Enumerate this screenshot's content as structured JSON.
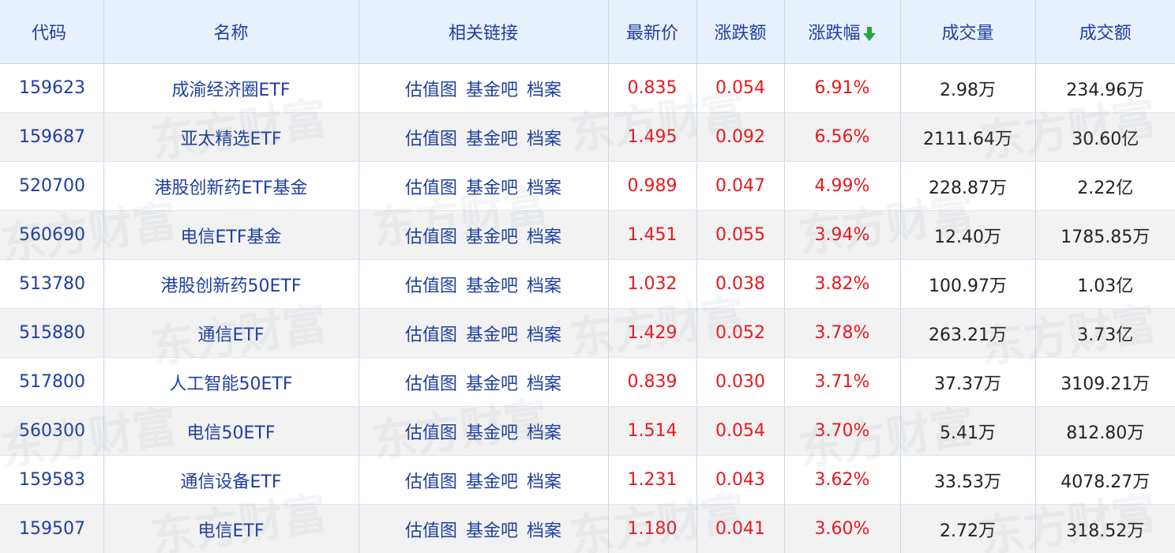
{
  "table": {
    "headers": [
      "代码",
      "名称",
      "相关链接",
      "最新价",
      "涨跌额",
      "涨跌幅",
      "成交量",
      "成交额"
    ],
    "sort_column": "涨跌幅",
    "sort_direction": "descending",
    "sort_icon": "green-arrow-down-icon",
    "link_labels": [
      "估值图",
      "基金吧",
      "档案"
    ],
    "rows": [
      {
        "code": "159623",
        "name": "成渝经济圈ETF",
        "price": "0.835",
        "change": "0.054",
        "pct": "6.91%",
        "volume": "2.98万",
        "amount": "234.96万"
      },
      {
        "code": "159687",
        "name": "亚太精选ETF",
        "price": "1.495",
        "change": "0.092",
        "pct": "6.56%",
        "volume": "2111.64万",
        "amount": "30.60亿"
      },
      {
        "code": "520700",
        "name": "港股创新药ETF基金",
        "price": "0.989",
        "change": "0.047",
        "pct": "4.99%",
        "volume": "228.87万",
        "amount": "2.22亿"
      },
      {
        "code": "560690",
        "name": "电信ETF基金",
        "price": "1.451",
        "change": "0.055",
        "pct": "3.94%",
        "volume": "12.40万",
        "amount": "1785.85万"
      },
      {
        "code": "513780",
        "name": "港股创新药50ETF",
        "price": "1.032",
        "change": "0.038",
        "pct": "3.82%",
        "volume": "100.97万",
        "amount": "1.03亿"
      },
      {
        "code": "515880",
        "name": "通信ETF",
        "price": "1.429",
        "change": "0.052",
        "pct": "3.78%",
        "volume": "263.21万",
        "amount": "3.73亿"
      },
      {
        "code": "517800",
        "name": "人工智能50ETF",
        "price": "0.839",
        "change": "0.030",
        "pct": "3.71%",
        "volume": "37.37万",
        "amount": "3109.21万"
      },
      {
        "code": "560300",
        "name": "电信50ETF",
        "price": "1.514",
        "change": "0.054",
        "pct": "3.70%",
        "volume": "5.41万",
        "amount": "812.80万"
      },
      {
        "code": "159583",
        "name": "通信设备ETF",
        "price": "1.231",
        "change": "0.043",
        "pct": "3.62%",
        "volume": "33.53万",
        "amount": "4078.27万"
      },
      {
        "code": "159507",
        "name": "电信ETF",
        "price": "1.180",
        "change": "0.041",
        "pct": "3.60%",
        "volume": "2.72万",
        "amount": "318.52万"
      }
    ]
  },
  "watermark": {
    "text": "东方财富"
  },
  "colors": {
    "header_bg": "#e7f1fd",
    "header_text": "#1f3fa0",
    "link": "#1f3fa0",
    "up_red": "#e8181e",
    "sort_green": "#2aa63a",
    "alt_row": "#f2f2f2"
  }
}
